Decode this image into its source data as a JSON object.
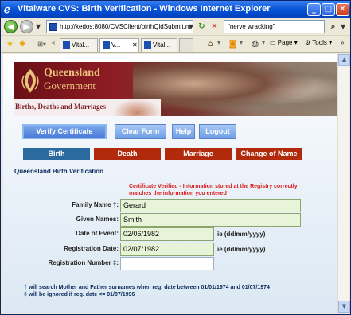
{
  "window": {
    "title": "Vitalware CVS: Birth Verification - Windows Internet Explorer"
  },
  "address": {
    "url": "http://kedos:8080/CVSClient/birthQldSubmit.m",
    "search_text": "\"nerve wracking\""
  },
  "tabs": [
    {
      "label": "Vital..."
    },
    {
      "label": "V..."
    },
    {
      "label": "Vital..."
    }
  ],
  "toolbar": {
    "page_label": "Page",
    "tools_label": "Tools"
  },
  "banner": {
    "gov_line1": "Queensland",
    "gov_line2": "Government",
    "section": "Births, Deaths and Marriages"
  },
  "actions": {
    "verify": "Verify Certificate",
    "clear": "Clear Form",
    "help": "Help",
    "logout": "Logout"
  },
  "nav": {
    "birth": "Birth",
    "death": "Death",
    "marriage": "Marriage",
    "change": "Change of Name"
  },
  "form": {
    "title": "Queensland Birth Verification",
    "notice": "Certificate Verified - Information stored at the Registry correctly matches the information you entered",
    "family_label": "Family Name †:",
    "family_value": "Gerard",
    "given_label": "Given Names:",
    "given_value": "Smith",
    "event_label": "Date of Event:",
    "event_value": "02/06/1982",
    "event_hint": "ie (dd/mm/yyyy)",
    "reg_label": "Registration Date:",
    "reg_value": "02/07/1982",
    "reg_hint": "ie (dd/mm/yyyy)",
    "regnum_label": "Registration Number ‡:",
    "regnum_value": ""
  },
  "footnotes": {
    "note1": "† will search Mother and Father surnames when reg. date between 01/01/1974 and 01/07/1974",
    "note2": "‡ will be ignored if reg. date <= 01/07/1996"
  },
  "colors": {
    "title_bar": "#0a55d8",
    "birth_tab": "#2a6a9e",
    "red_tab": "#b22a0c",
    "notice": "#d81818"
  }
}
